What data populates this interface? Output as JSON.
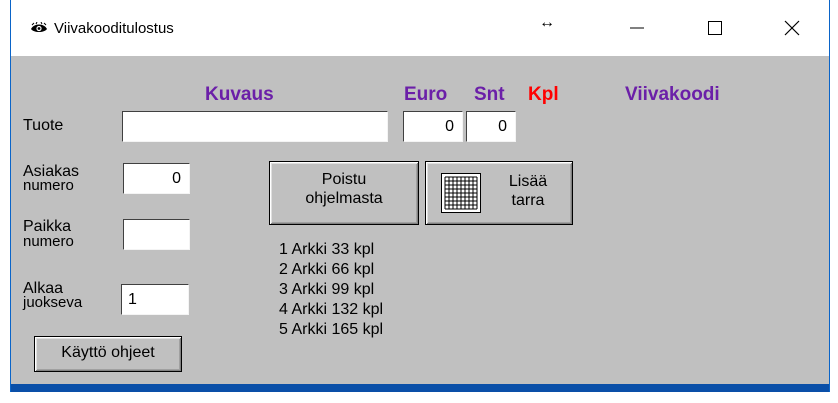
{
  "window": {
    "title": "Viivakooditulostus",
    "resize_glyph": "↔",
    "controls": {
      "minimize": "minimize-icon",
      "maximize": "maximize-icon",
      "close": "close-icon"
    }
  },
  "headers": {
    "kuvaus": "Kuvaus",
    "euro": "Euro",
    "snt": "Snt",
    "kpl": "Kpl",
    "viivakoodi": "Viivakoodi"
  },
  "colors": {
    "header": "#6b1fa8",
    "kpl": "#ff0000",
    "face": "#c0c0c0"
  },
  "labels": {
    "tuote": "Tuote",
    "asiakas_1": "Asiakas",
    "asiakas_2": "numero",
    "paikka_1": "Paikka",
    "paikka_2": "numero",
    "alkaa_1": "Alkaa",
    "alkaa_2": "juokseva"
  },
  "fields": {
    "kuvaus": "",
    "euro": "0",
    "snt": "0",
    "asiakas": "0",
    "paikka": "",
    "alkaa": "1"
  },
  "buttons": {
    "poistu_1": "Poistu",
    "poistu_2": "ohjelmasta",
    "lisaa_1": "Lisää",
    "lisaa_2": "tarra",
    "kaytto": "Käyttö ohjeet"
  },
  "sheets": [
    "1 Arkki 33 kpl",
    "2 Arkki 66 kpl",
    "3 Arkki 99 kpl",
    "4 Arkki 132 kpl",
    "5 Arkki 165 kpl"
  ]
}
